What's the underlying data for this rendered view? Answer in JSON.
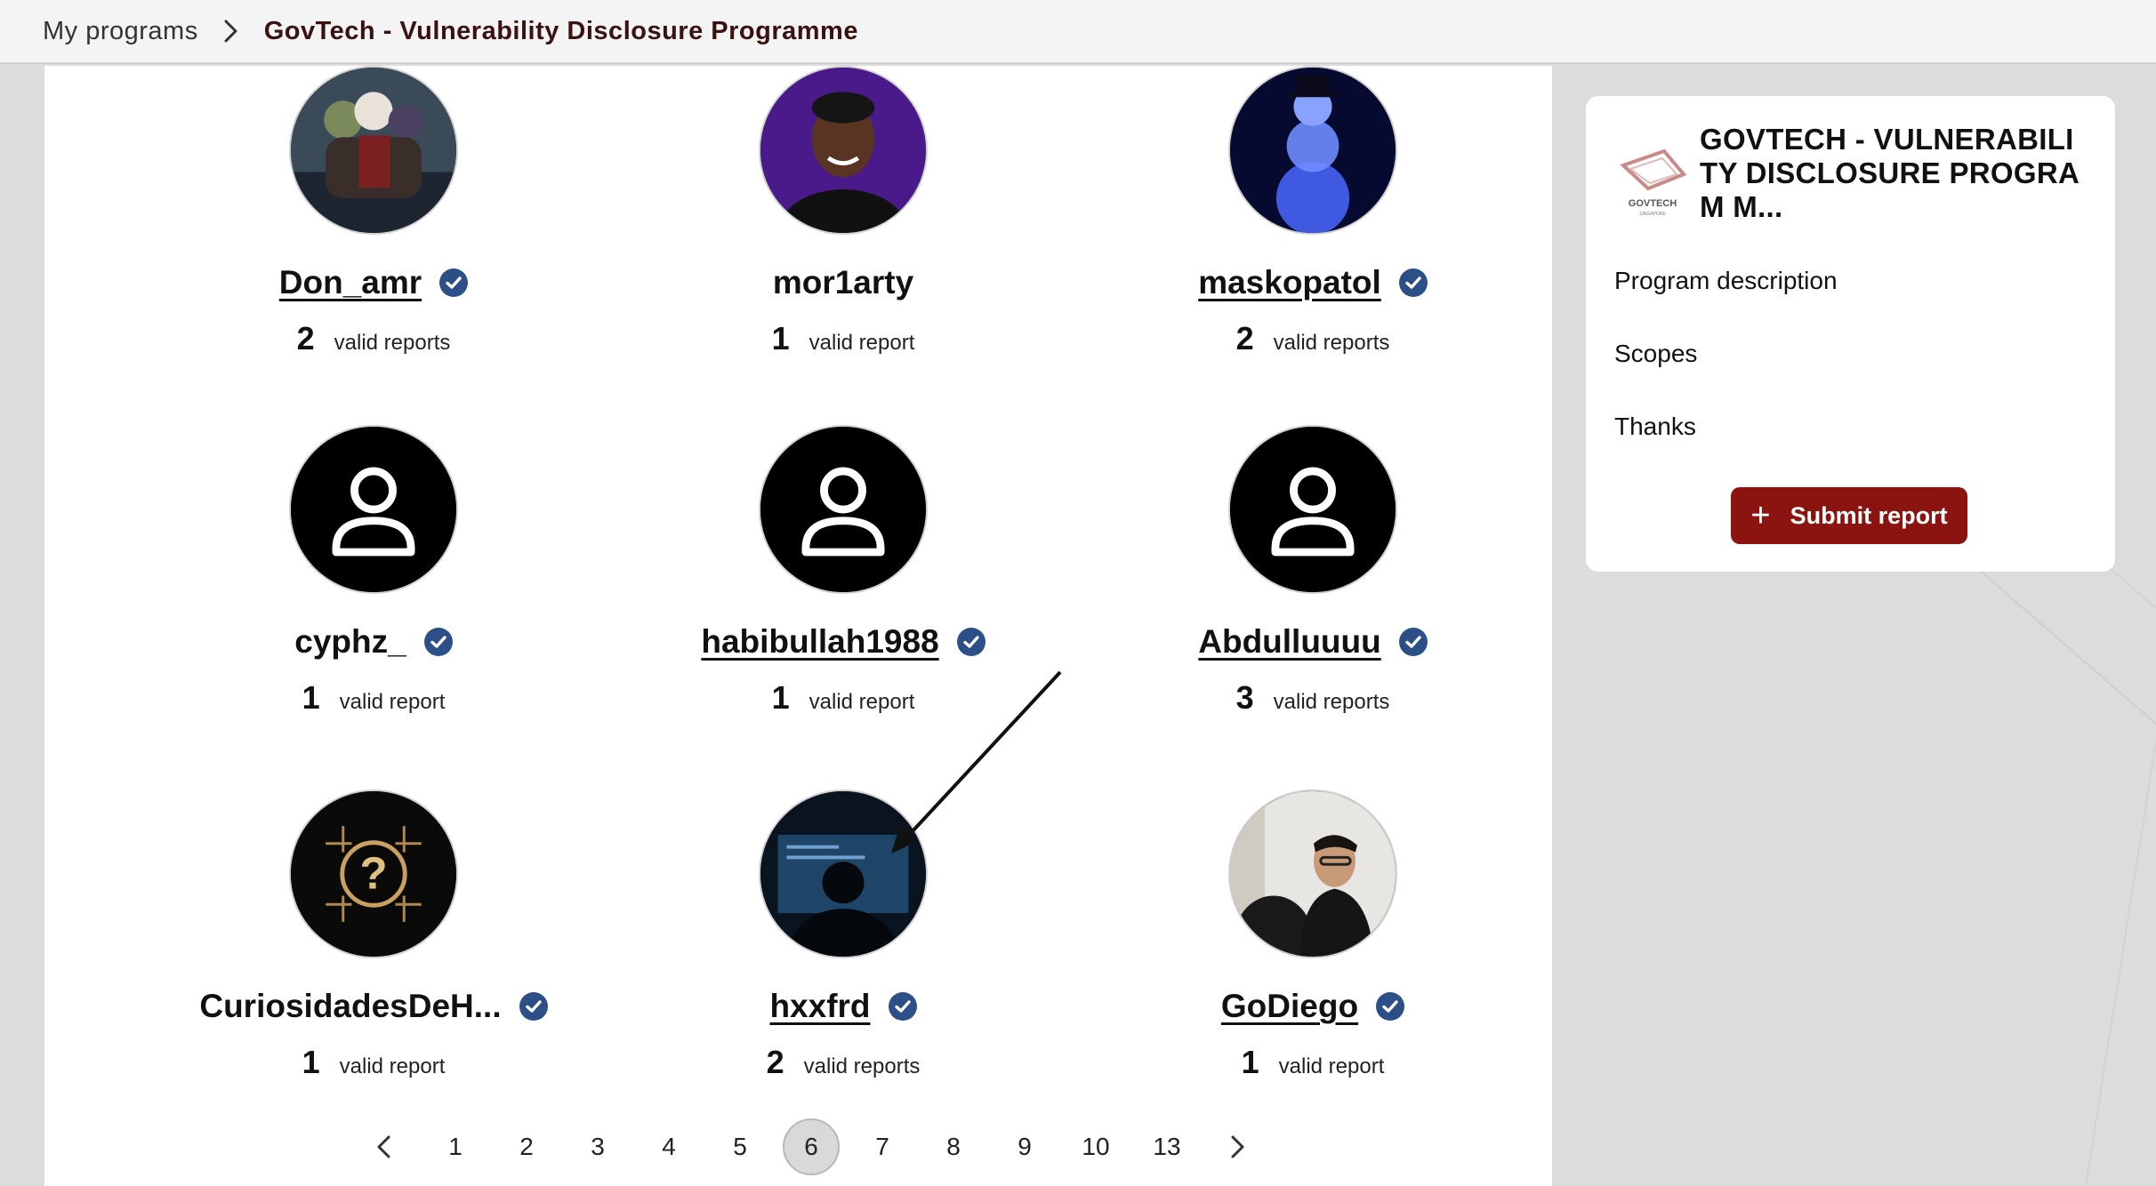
{
  "breadcrumb": {
    "root": "My programs",
    "current": "GovTech - Vulnerability Disclosure Programme"
  },
  "researchers": [
    {
      "name": "Don_amr",
      "count": "2",
      "label": "valid reports",
      "verified": true,
      "link": true,
      "avatar": "anime-group-photo"
    },
    {
      "name": "mor1arty",
      "count": "1",
      "label": "valid report",
      "verified": false,
      "link": false,
      "avatar": "portrait-photo"
    },
    {
      "name": "maskopatol",
      "count": "2",
      "label": "valid reports",
      "verified": true,
      "link": true,
      "avatar": "snowman-photo"
    },
    {
      "name": "cyphz_",
      "count": "1",
      "label": "valid report",
      "verified": true,
      "link": false,
      "avatar": "default-user-icon"
    },
    {
      "name": "habibullah1988",
      "count": "1",
      "label": "valid report",
      "verified": true,
      "link": true,
      "avatar": "default-user-icon"
    },
    {
      "name": "Abdulluuuu",
      "count": "3",
      "label": "valid reports",
      "verified": true,
      "link": true,
      "avatar": "default-user-icon"
    },
    {
      "name": "CuriosidadesDeH...",
      "count": "1",
      "label": "valid report",
      "verified": true,
      "link": false,
      "avatar": "circuit-question-icon"
    },
    {
      "name": "hxxfrd",
      "count": "2",
      "label": "valid reports",
      "verified": true,
      "link": true,
      "avatar": "hacker-monitor-photo"
    },
    {
      "name": "GoDiego",
      "count": "1",
      "label": "valid report",
      "verified": true,
      "link": true,
      "avatar": "person-photo"
    }
  ],
  "pagination": {
    "pages": [
      "1",
      "2",
      "3",
      "4",
      "5",
      "6",
      "7",
      "8",
      "9",
      "10",
      "13"
    ],
    "current": "6"
  },
  "sidebar": {
    "title": "GOVTECH - VULNERABILITY DISCLOSURE PROGRAM M...",
    "logo_text": "GOVTECH",
    "logo_subtext": "SINGAPORE",
    "links": [
      "Program description",
      "Scopes",
      "Thanks"
    ],
    "submit_label": "Submit report",
    "submit_icon": "plus-icon"
  },
  "colors": {
    "brand_red": "#8b1410",
    "verified_blue": "#2b4f86",
    "active_page": "#d9d9d9"
  }
}
